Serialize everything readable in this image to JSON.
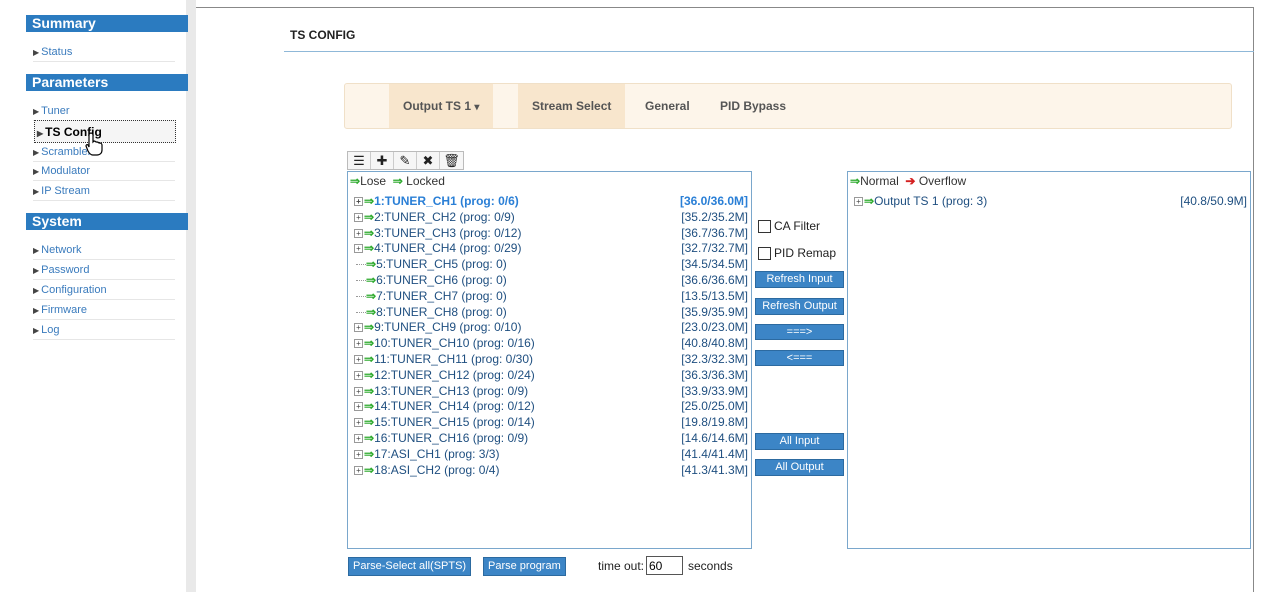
{
  "sidebar": {
    "sections": [
      {
        "title": "Summary",
        "items": [
          {
            "label": "Status"
          }
        ]
      },
      {
        "title": "Parameters",
        "items": [
          {
            "label": "Tuner"
          },
          {
            "label": "TS Config"
          },
          {
            "label": "Scrambler"
          },
          {
            "label": "Modulator"
          },
          {
            "label": "IP Stream"
          }
        ]
      },
      {
        "title": "System",
        "items": [
          {
            "label": "Network"
          },
          {
            "label": "Password"
          },
          {
            "label": "Configuration"
          },
          {
            "label": "Firmware"
          },
          {
            "label": "Log"
          }
        ]
      }
    ],
    "active_item": "TS Config"
  },
  "page": {
    "title": "TS CONFIG"
  },
  "tabs": [
    {
      "label": "Output TS 1",
      "caret": "▾"
    },
    {
      "label": "Stream Select"
    },
    {
      "label": "General"
    },
    {
      "label": "PID Bypass"
    }
  ],
  "toolbar": {
    "icons": [
      "list-icon",
      "plus-icon",
      "pencil-icon",
      "close-icon",
      "trash-icon"
    ],
    "glyphs": [
      "☰",
      "✚",
      "✎",
      "✖",
      "🗑"
    ]
  },
  "input_panel": {
    "legend": {
      "lose": "Lose",
      "locked": "Locked"
    },
    "rows": [
      {
        "label": "1:TUNER_CH1 (prog: 0/6)",
        "rate": "[36.0/36.0M]",
        "expandable": true,
        "selected": true
      },
      {
        "label": "2:TUNER_CH2 (prog: 0/9)",
        "rate": "[35.2/35.2M]",
        "expandable": true
      },
      {
        "label": "3:TUNER_CH3 (prog: 0/12)",
        "rate": "[36.7/36.7M]",
        "expandable": true
      },
      {
        "label": "4:TUNER_CH4 (prog: 0/29)",
        "rate": "[32.7/32.7M]",
        "expandable": true
      },
      {
        "label": "5:TUNER_CH5 (prog: 0)",
        "rate": "[34.5/34.5M]",
        "expandable": false
      },
      {
        "label": "6:TUNER_CH6 (prog: 0)",
        "rate": "[36.6/36.6M]",
        "expandable": false
      },
      {
        "label": "7:TUNER_CH7 (prog: 0)",
        "rate": "[13.5/13.5M]",
        "expandable": false
      },
      {
        "label": "8:TUNER_CH8 (prog: 0)",
        "rate": "[35.9/35.9M]",
        "expandable": false
      },
      {
        "label": "9:TUNER_CH9 (prog: 0/10)",
        "rate": "[23.0/23.0M]",
        "expandable": true
      },
      {
        "label": "10:TUNER_CH10 (prog: 0/16)",
        "rate": "[40.8/40.8M]",
        "expandable": true
      },
      {
        "label": "11:TUNER_CH11 (prog: 0/30)",
        "rate": "[32.3/32.3M]",
        "expandable": true
      },
      {
        "label": "12:TUNER_CH12 (prog: 0/24)",
        "rate": "[36.3/36.3M]",
        "expandable": true
      },
      {
        "label": "13:TUNER_CH13 (prog: 0/9)",
        "rate": "[33.9/33.9M]",
        "expandable": true
      },
      {
        "label": "14:TUNER_CH14 (prog: 0/12)",
        "rate": "[25.0/25.0M]",
        "expandable": true
      },
      {
        "label": "15:TUNER_CH15 (prog: 0/14)",
        "rate": "[19.8/19.8M]",
        "expandable": true
      },
      {
        "label": "16:TUNER_CH16 (prog: 0/9)",
        "rate": "[14.6/14.6M]",
        "expandable": true
      },
      {
        "label": "17:ASI_CH1 (prog: 3/3)",
        "rate": "[41.4/41.4M]",
        "expandable": true
      },
      {
        "label": "18:ASI_CH2 (prog: 0/4)",
        "rate": "[41.3/41.3M]",
        "expandable": true
      }
    ]
  },
  "output_panel": {
    "legend": {
      "normal": "Normal",
      "overflow": "Overflow"
    },
    "rows": [
      {
        "label": "Output TS 1 (prog: 3)",
        "rate": "[40.8/50.9M]",
        "expandable": true
      }
    ]
  },
  "middle": {
    "ca_filter": "CA Filter",
    "pid_remap": "PID Remap",
    "refresh_input": "Refresh Input",
    "refresh_output": "Refresh Output",
    "move_right": "===>",
    "move_left": "<===",
    "all_input": "All Input",
    "all_output": "All Output"
  },
  "footer": {
    "parse_select_all": "Parse-Select all(SPTS)",
    "parse_program": "Parse program",
    "timeout_label": "time out:",
    "timeout_value": "60",
    "seconds_label": "seconds"
  },
  "colors": {
    "accent": "#2b7bc0",
    "button": "#3c85c6",
    "tab_bg": "#fdf5ea",
    "lock_green": "#2eaa2e",
    "overflow_red": "#d42020"
  }
}
